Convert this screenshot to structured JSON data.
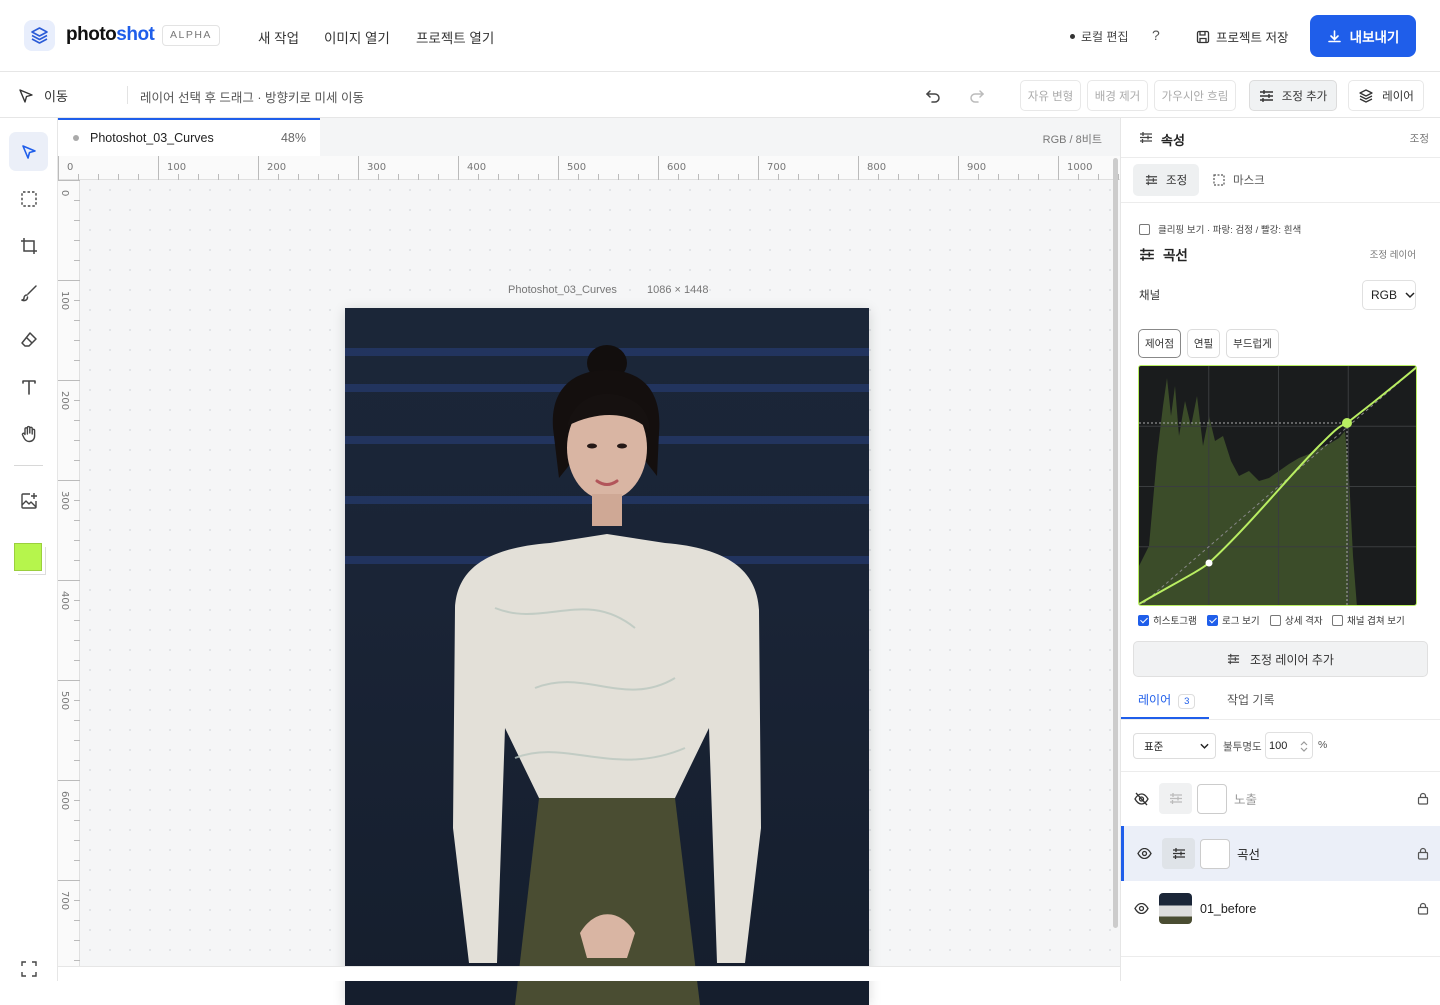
{
  "app": {
    "logo_prefix": "photo",
    "logo_suffix": "shot",
    "badge": "ALPHA"
  },
  "top_menu": [
    "새 작업",
    "이미지 열기",
    "프로젝트 열기"
  ],
  "top_right": {
    "local_edit": "로컬 편집",
    "help": "?",
    "save_project": "프로젝트 저장",
    "export": "내보내기"
  },
  "toolbar": {
    "move_label": "이동",
    "hint": "레이어 선택 후 드래그 · 방향키로 미세 이동",
    "free_transform": "자유 변형",
    "remove_bg": "배경 제거",
    "gaussian_blur": "가우시안 흐림",
    "add_adjustment": "조정 추가",
    "layers": "레이어"
  },
  "document": {
    "tab_name": "Photoshot_03_Curves",
    "zoom": "48%",
    "color_info": "RGB / 8비트",
    "caption": "Photoshot_03_Curves",
    "dimensions": "1086 × 1448"
  },
  "ruler": {
    "h_labels": [
      "0",
      "100",
      "200",
      "300",
      "400",
      "500",
      "600",
      "700",
      "800",
      "900",
      "1000"
    ],
    "v_labels": [
      "0",
      "100",
      "200",
      "300",
      "400",
      "500",
      "600",
      "700"
    ]
  },
  "colors": {
    "foreground": "#b6f54c",
    "accent": "#1f5eea",
    "curve": "#b9ee62"
  },
  "properties": {
    "title": "속성",
    "subtitle": "조정",
    "tab_adjust": "조정",
    "tab_mask": "마스크",
    "clip_label": "클리핑 보기 · 파랑: 검정 / 빨강: 흰색",
    "curve_title": "곡선",
    "adjustment_layer": "조정 레이어",
    "channel_label": "채널",
    "channel_value": "RGB",
    "modes": [
      "제어점",
      "연필",
      "부드럽게"
    ],
    "options": [
      {
        "label": "히스토그램",
        "checked": true
      },
      {
        "label": "로그 보기",
        "checked": true
      },
      {
        "label": "상세 격자",
        "checked": false
      },
      {
        "label": "채널 겹쳐 보기",
        "checked": false
      }
    ],
    "add_adjustment_layer": "조정 레이어 추가"
  },
  "layers_panel": {
    "tab_layers": "레이어",
    "layer_count": "3",
    "tab_history": "작업 기록",
    "blend_mode": "표준",
    "opacity_label": "불투명도",
    "opacity_value": "100",
    "opacity_unit": "%",
    "layers": [
      {
        "name": "노출",
        "visible": false
      },
      {
        "name": "곡선",
        "visible": true
      },
      {
        "name": "01_before",
        "visible": true
      }
    ]
  }
}
